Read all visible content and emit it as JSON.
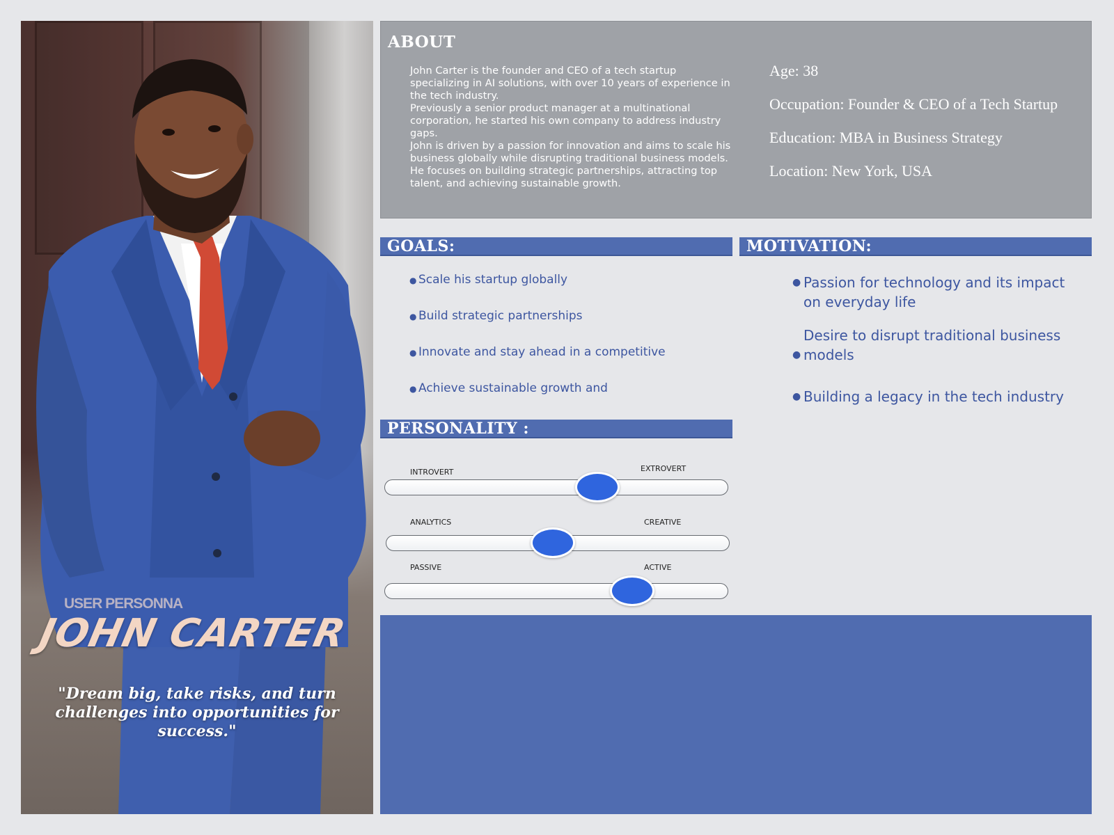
{
  "persona": {
    "label": "USER PERSONNA",
    "name": "JOHN CARTER",
    "quote": "\"Dream big, take risks, and turn challenges into opportunities for success.\""
  },
  "about": {
    "title": "ABOUT",
    "paragraphs": [
      "John Carter is the founder and CEO of a tech startup specializing in AI solutions, with over 10 years of experience in the tech industry.",
      "Previously a senior product manager at a multinational corporation, he started his own company to address industry gaps.",
      "John is driven by a passion for innovation and aims to scale his business globally while disrupting traditional business models.",
      "He focuses on building strategic partnerships, attracting top talent, and achieving sustainable growth."
    ],
    "facts": [
      "Age: 38",
      "Occupation: Founder & CEO of a Tech Startup",
      "Education: MBA in Business Strategy",
      "Location: New York, USA"
    ]
  },
  "goals": {
    "title": "GOALS:",
    "items": [
      "Scale his startup globally",
      "Build strategic partnerships",
      "Innovate and stay ahead in a competitive",
      "Achieve sustainable growth and"
    ]
  },
  "motivation": {
    "title": "MOTIVATION:",
    "items": [
      "Passion for technology and its impact on everyday life",
      "Desire to disrupt traditional business models",
      "Building a legacy in the tech industry"
    ]
  },
  "personality": {
    "title": "PERSONALITY :",
    "sliders": [
      {
        "left": "INTROVERT",
        "right": "EXTROVERT",
        "level": 0.62
      },
      {
        "left": "ANALYTICS",
        "right": "CREATIVE",
        "level": 0.49
      },
      {
        "left": "PASSIVE",
        "right": "ACTIVE",
        "level": 0.72
      }
    ]
  },
  "colors": {
    "accent_blue": "#506cb0",
    "knob_blue": "#2f65de",
    "about_gray": "#9fa2a7",
    "text_blue": "#3d56a0",
    "name_peach": "#f3d6c4"
  },
  "icons": {
    "bullet": "bullet-dot-icon"
  }
}
